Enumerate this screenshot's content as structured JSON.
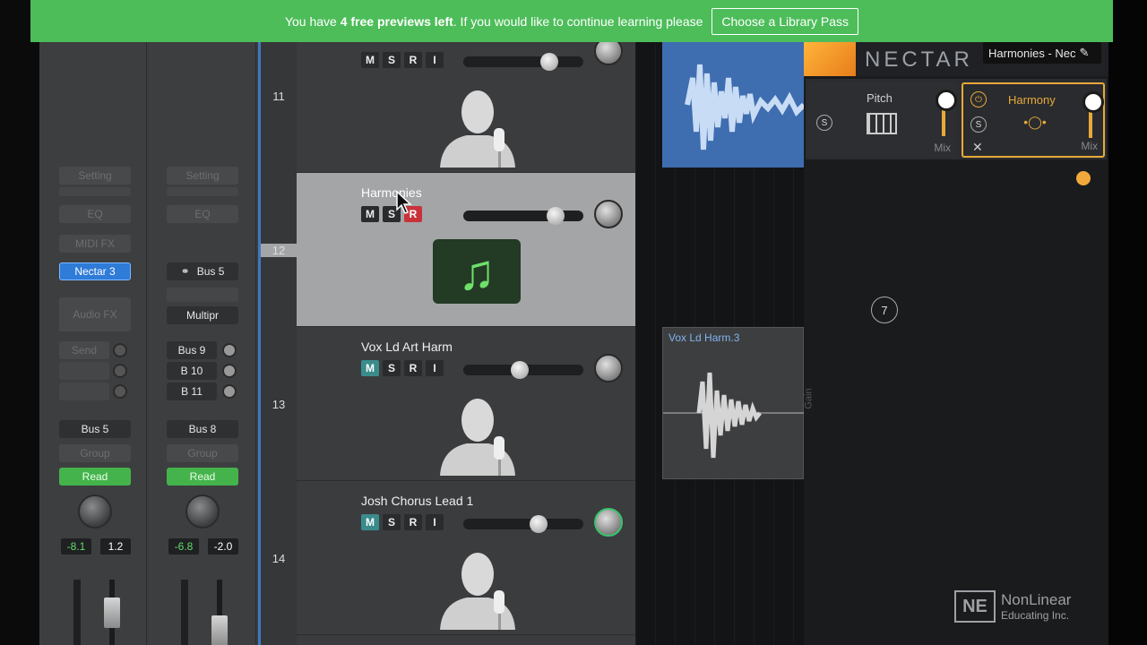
{
  "banner": {
    "text_before": "You have ",
    "count_text": "4 free previews left",
    "text_after": ". If you would like to continue learning please",
    "cta_label": "Choose a Library Pass"
  },
  "inspector": {
    "left_strip": {
      "setting": "Setting",
      "eq": "EQ",
      "midi_fx": "MIDI FX",
      "plugin": "Nectar 3",
      "audio_fx": "Audio FX",
      "send": "Send",
      "output": "Bus 5",
      "group": "Group",
      "automation": "Read",
      "pan_value": "-8.1",
      "volume_value": "1.2"
    },
    "right_strip": {
      "setting": "Setting",
      "eq": "EQ",
      "input": "Bus 5",
      "plugin": "Multipr",
      "sends": [
        "Bus 9",
        "B 10",
        "B 11"
      ],
      "output": "Bus 8",
      "group": "Group",
      "automation": "Read",
      "pan_value": "-6.8",
      "volume_value": "-2.0"
    }
  },
  "tracks": [
    {
      "number": "11",
      "name": "",
      "m": "M",
      "s": "S",
      "r": "R",
      "i": "I",
      "volume": 0.72
    },
    {
      "number": "12",
      "name": "Harmonies",
      "m": "M",
      "s": "S",
      "r": "R",
      "volume": 0.77
    },
    {
      "number": "13",
      "name": "Vox Ld Art Harm",
      "m": "M",
      "s": "S",
      "r": "R",
      "i": "I",
      "volume": 0.47
    },
    {
      "number": "14",
      "name": "Josh Chorus Lead 1",
      "m": "M",
      "s": "S",
      "r": "R",
      "i": "I",
      "volume": 0.63
    }
  ],
  "arrange": {
    "region_name": "Vox Ld Harm.3",
    "gain_label": "Gain"
  },
  "plugin": {
    "brand": "NECTAR",
    "preset": "Harmonies - Nec",
    "modules": [
      {
        "name": "Pitch",
        "mix_label": "Mix"
      },
      {
        "name": "Harmony",
        "mix_label": "Mix"
      }
    ],
    "badge": "7",
    "watermark_line1": "NonLinear",
    "watermark_line2": "Educating Inc.",
    "watermark_box": "NE"
  },
  "colors": {
    "banner": "#4dbd5a",
    "accent_blue": "#2e7bd8",
    "harmony_orange": "#e8a93a",
    "read_green": "#45b34b"
  }
}
